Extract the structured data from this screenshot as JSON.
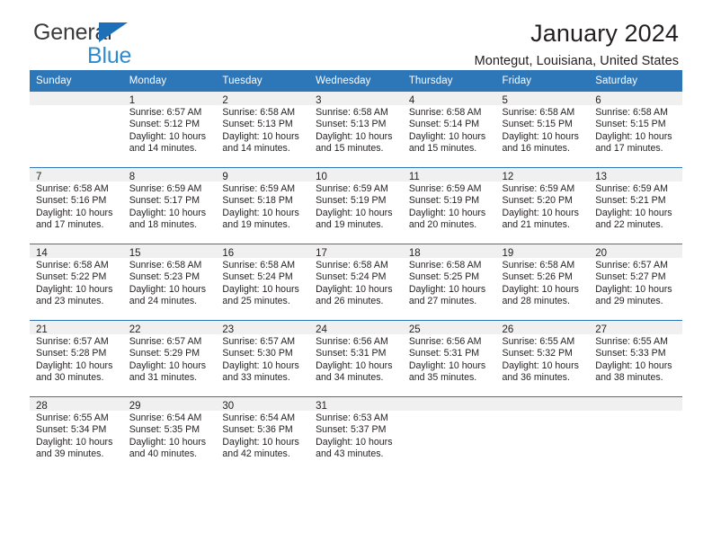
{
  "brand": {
    "name_part1": "General",
    "name_part2": "Blue",
    "accent_color": "#1d70b7",
    "logo_blue_color": "#2e8bd0",
    "triangle_icon": "triangle-icon"
  },
  "header": {
    "title": "January 2024",
    "subtitle": "Montegut, Louisiana, United States"
  },
  "theme": {
    "header_row_background": "#2d76b8",
    "header_row_text": "#ffffff",
    "daynum_background": "#f0f0f0",
    "week_divider": "#2d76b8",
    "body_text": "#231f20"
  },
  "weekday_headers": [
    "Sunday",
    "Monday",
    "Tuesday",
    "Wednesday",
    "Thursday",
    "Friday",
    "Saturday"
  ],
  "weeks": [
    [
      {
        "day": "",
        "lines": []
      },
      {
        "day": "1",
        "lines": [
          "Sunrise: 6:57 AM",
          "Sunset: 5:12 PM",
          "Daylight: 10 hours",
          "and 14 minutes."
        ]
      },
      {
        "day": "2",
        "lines": [
          "Sunrise: 6:58 AM",
          "Sunset: 5:13 PM",
          "Daylight: 10 hours",
          "and 14 minutes."
        ]
      },
      {
        "day": "3",
        "lines": [
          "Sunrise: 6:58 AM",
          "Sunset: 5:13 PM",
          "Daylight: 10 hours",
          "and 15 minutes."
        ]
      },
      {
        "day": "4",
        "lines": [
          "Sunrise: 6:58 AM",
          "Sunset: 5:14 PM",
          "Daylight: 10 hours",
          "and 15 minutes."
        ]
      },
      {
        "day": "5",
        "lines": [
          "Sunrise: 6:58 AM",
          "Sunset: 5:15 PM",
          "Daylight: 10 hours",
          "and 16 minutes."
        ]
      },
      {
        "day": "6",
        "lines": [
          "Sunrise: 6:58 AM",
          "Sunset: 5:15 PM",
          "Daylight: 10 hours",
          "and 17 minutes."
        ]
      }
    ],
    [
      {
        "day": "7",
        "lines": [
          "Sunrise: 6:58 AM",
          "Sunset: 5:16 PM",
          "Daylight: 10 hours",
          "and 17 minutes."
        ]
      },
      {
        "day": "8",
        "lines": [
          "Sunrise: 6:59 AM",
          "Sunset: 5:17 PM",
          "Daylight: 10 hours",
          "and 18 minutes."
        ]
      },
      {
        "day": "9",
        "lines": [
          "Sunrise: 6:59 AM",
          "Sunset: 5:18 PM",
          "Daylight: 10 hours",
          "and 19 minutes."
        ]
      },
      {
        "day": "10",
        "lines": [
          "Sunrise: 6:59 AM",
          "Sunset: 5:19 PM",
          "Daylight: 10 hours",
          "and 19 minutes."
        ]
      },
      {
        "day": "11",
        "lines": [
          "Sunrise: 6:59 AM",
          "Sunset: 5:19 PM",
          "Daylight: 10 hours",
          "and 20 minutes."
        ]
      },
      {
        "day": "12",
        "lines": [
          "Sunrise: 6:59 AM",
          "Sunset: 5:20 PM",
          "Daylight: 10 hours",
          "and 21 minutes."
        ]
      },
      {
        "day": "13",
        "lines": [
          "Sunrise: 6:59 AM",
          "Sunset: 5:21 PM",
          "Daylight: 10 hours",
          "and 22 minutes."
        ]
      }
    ],
    [
      {
        "day": "14",
        "lines": [
          "Sunrise: 6:58 AM",
          "Sunset: 5:22 PM",
          "Daylight: 10 hours",
          "and 23 minutes."
        ]
      },
      {
        "day": "15",
        "lines": [
          "Sunrise: 6:58 AM",
          "Sunset: 5:23 PM",
          "Daylight: 10 hours",
          "and 24 minutes."
        ]
      },
      {
        "day": "16",
        "lines": [
          "Sunrise: 6:58 AM",
          "Sunset: 5:24 PM",
          "Daylight: 10 hours",
          "and 25 minutes."
        ]
      },
      {
        "day": "17",
        "lines": [
          "Sunrise: 6:58 AM",
          "Sunset: 5:24 PM",
          "Daylight: 10 hours",
          "and 26 minutes."
        ]
      },
      {
        "day": "18",
        "lines": [
          "Sunrise: 6:58 AM",
          "Sunset: 5:25 PM",
          "Daylight: 10 hours",
          "and 27 minutes."
        ]
      },
      {
        "day": "19",
        "lines": [
          "Sunrise: 6:58 AM",
          "Sunset: 5:26 PM",
          "Daylight: 10 hours",
          "and 28 minutes."
        ]
      },
      {
        "day": "20",
        "lines": [
          "Sunrise: 6:57 AM",
          "Sunset: 5:27 PM",
          "Daylight: 10 hours",
          "and 29 minutes."
        ]
      }
    ],
    [
      {
        "day": "21",
        "lines": [
          "Sunrise: 6:57 AM",
          "Sunset: 5:28 PM",
          "Daylight: 10 hours",
          "and 30 minutes."
        ]
      },
      {
        "day": "22",
        "lines": [
          "Sunrise: 6:57 AM",
          "Sunset: 5:29 PM",
          "Daylight: 10 hours",
          "and 31 minutes."
        ]
      },
      {
        "day": "23",
        "lines": [
          "Sunrise: 6:57 AM",
          "Sunset: 5:30 PM",
          "Daylight: 10 hours",
          "and 33 minutes."
        ]
      },
      {
        "day": "24",
        "lines": [
          "Sunrise: 6:56 AM",
          "Sunset: 5:31 PM",
          "Daylight: 10 hours",
          "and 34 minutes."
        ]
      },
      {
        "day": "25",
        "lines": [
          "Sunrise: 6:56 AM",
          "Sunset: 5:31 PM",
          "Daylight: 10 hours",
          "and 35 minutes."
        ]
      },
      {
        "day": "26",
        "lines": [
          "Sunrise: 6:55 AM",
          "Sunset: 5:32 PM",
          "Daylight: 10 hours",
          "and 36 minutes."
        ]
      },
      {
        "day": "27",
        "lines": [
          "Sunrise: 6:55 AM",
          "Sunset: 5:33 PM",
          "Daylight: 10 hours",
          "and 38 minutes."
        ]
      }
    ],
    [
      {
        "day": "28",
        "lines": [
          "Sunrise: 6:55 AM",
          "Sunset: 5:34 PM",
          "Daylight: 10 hours",
          "and 39 minutes."
        ]
      },
      {
        "day": "29",
        "lines": [
          "Sunrise: 6:54 AM",
          "Sunset: 5:35 PM",
          "Daylight: 10 hours",
          "and 40 minutes."
        ]
      },
      {
        "day": "30",
        "lines": [
          "Sunrise: 6:54 AM",
          "Sunset: 5:36 PM",
          "Daylight: 10 hours",
          "and 42 minutes."
        ]
      },
      {
        "day": "31",
        "lines": [
          "Sunrise: 6:53 AM",
          "Sunset: 5:37 PM",
          "Daylight: 10 hours",
          "and 43 minutes."
        ]
      },
      {
        "day": "",
        "lines": []
      },
      {
        "day": "",
        "lines": []
      },
      {
        "day": "",
        "lines": []
      }
    ]
  ]
}
